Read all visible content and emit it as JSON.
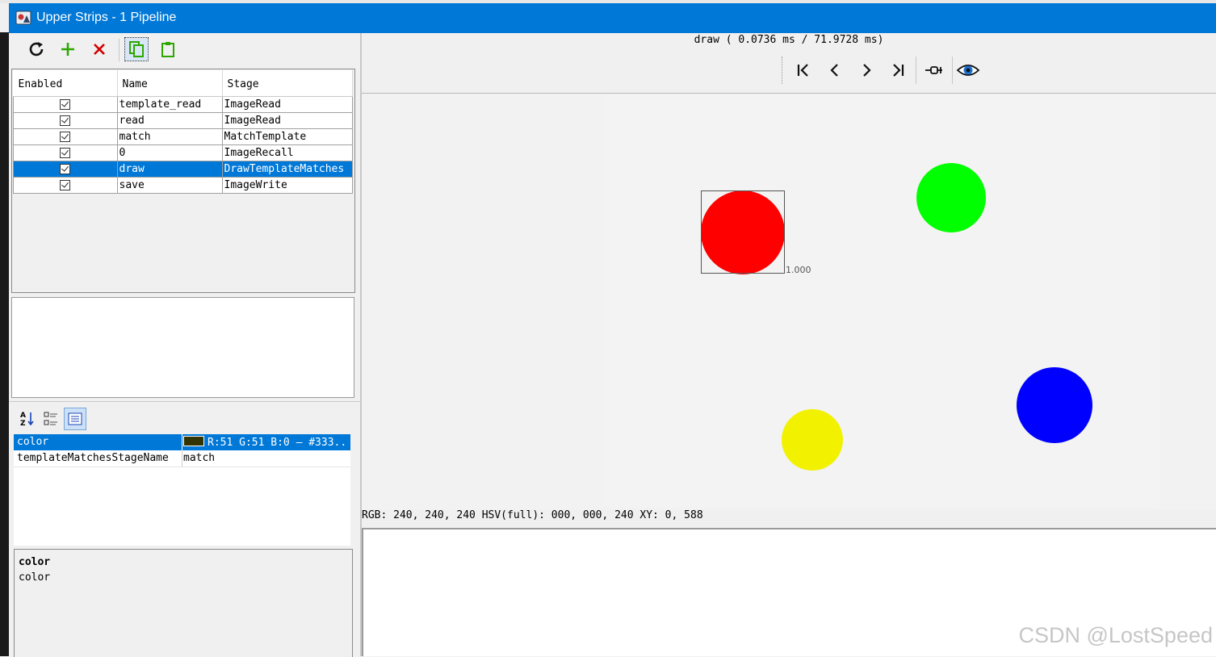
{
  "window": {
    "title": "Upper Strips - 1 Pipeline"
  },
  "toolbar": {
    "icons": [
      "refresh-icon",
      "add-icon",
      "delete-icon",
      "copy-icon",
      "paste-icon"
    ],
    "colors": {
      "add": "#2ea600",
      "delete": "#d40000",
      "copy": "#2ea600",
      "paste": "#2ea600"
    }
  },
  "pipeline": {
    "headers": {
      "enabled": "Enabled",
      "name": "Name",
      "stage": "Stage"
    },
    "rows": [
      {
        "enabled": true,
        "name": "template_read",
        "stage": "ImageRead"
      },
      {
        "enabled": true,
        "name": "read",
        "stage": "ImageRead"
      },
      {
        "enabled": true,
        "name": "match",
        "stage": "MatchTemplate"
      },
      {
        "enabled": true,
        "name": "0",
        "stage": "ImageRecall"
      },
      {
        "enabled": true,
        "name": "draw",
        "stage": "DrawTemplateMatches",
        "selected": true
      },
      {
        "enabled": true,
        "name": "save",
        "stage": "ImageWrite"
      }
    ]
  },
  "properties": {
    "toolbar_icons": [
      "sort-alphabetical-icon",
      "categorized-icon",
      "property-pages-icon"
    ],
    "rows": [
      {
        "key": "color",
        "value": "R:51 G:51 B:0 – #333..",
        "swatch": "#333300",
        "selected": true
      },
      {
        "key": "templateMatchesStageName",
        "value": "match"
      }
    ],
    "description": {
      "title": "color",
      "text": "color"
    }
  },
  "viewer": {
    "timing": "draw ( 0.0736 ms / 71.9728 ms)",
    "nav_icons": [
      "first-icon",
      "previous-icon",
      "next-icon",
      "last-icon",
      "pin-icon",
      "eye-icon"
    ],
    "pixel_info": "RGB: 240, 240, 240 HSV(full): 000, 000, 240 XY: 0, 588",
    "match_score": "1.000",
    "circle_colors": {
      "red": "#ff0000",
      "green": "#00ff00",
      "blue": "#0000ff",
      "yellow": "#f2f200"
    }
  },
  "watermark": "CSDN @LostSpeed"
}
